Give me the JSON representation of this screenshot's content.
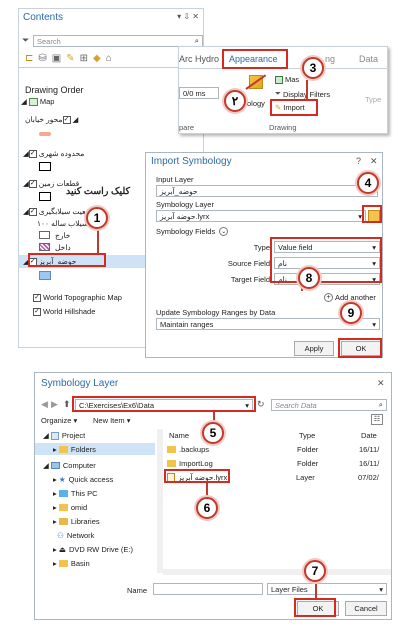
{
  "contents": {
    "title": "Contents",
    "search_placeholder": "Search",
    "drawing_order": "Drawing Order",
    "layers": {
      "map": "Map",
      "street_axis": "محور خیابان",
      "city_limit": "محدوده شهری",
      "land_parcels": "قطعات زمین",
      "flood_status": "وضعیت سیلابگیری",
      "flood_100": "۱۰۰ سیلاب ساله",
      "outside": "خارج",
      "inside": "داخل",
      "basin": "حوضه_آبریز",
      "topo": "World Topographic Map",
      "hillshade": "World Hillshade"
    },
    "callout_rightclick": "کلیک راست کنید"
  },
  "ribbon": {
    "tab_arc_hydro": "Arc Hydro",
    "tab_appearance": "Appearance",
    "tab_labeling": "ng",
    "tab_data": "Data",
    "zoom_value": "0/0 ms",
    "symbology_label": "ology",
    "mask": "Mas",
    "display_filters": "Display Filters",
    "import": "Import",
    "type_label": "Type",
    "group_compare": "pare",
    "group_drawing": "Drawing"
  },
  "import_dialog": {
    "title": "Import Symbology",
    "help": "?",
    "input_layer_label": "Input Layer",
    "input_layer_value": "حوضه_آبریز",
    "symbology_layer_label": "Symbology Layer",
    "symbology_layer_value": "حوضه آبریز.lyrx",
    "symbology_fields_label": "Symbology Fields",
    "type_label": "Type",
    "type_value": "Value field",
    "source_field_label": "Source Field",
    "source_field_value": "نام",
    "target_field_label": "Target Field",
    "target_field_value": "نام",
    "add_another": "Add another",
    "update_ranges_label": "Update Symbology Ranges by Data",
    "update_ranges_value": "Maintain ranges",
    "apply": "Apply",
    "ok": "OK"
  },
  "file_dialog": {
    "title": "Symbology Layer",
    "path": "C:\\Exercises\\Ex6\\Data",
    "search_placeholder": "Search Data",
    "organize": "Organize ▾",
    "new_item": "New Item ▾",
    "nav": [
      "Project",
      "Folders",
      "Computer",
      "Quick access",
      "This PC",
      "omid",
      "Libraries",
      "Network",
      "DVD RW Drive (E:)",
      "Basin"
    ],
    "columns": {
      "name": "Name",
      "type": "Type",
      "date": "Date"
    },
    "files": [
      {
        "name": ".backups",
        "type": "Folder",
        "date": "16/11/"
      },
      {
        "name": "ImportLog",
        "type": "Folder",
        "date": "16/11/"
      },
      {
        "name": "حوضه آبریز.lyrx",
        "type": "Layer",
        "date": "07/02/"
      }
    ],
    "name_label": "Name",
    "filter_value": "Layer Files",
    "ok": "OK",
    "cancel": "Cancel"
  },
  "markers": [
    "1",
    "۲",
    "3",
    "4",
    "5",
    "6",
    "7",
    "8",
    "9"
  ],
  "colors": {
    "accent_red": "#d42b20",
    "title_blue": "#2a6aa8",
    "selection_blue": "#cfe3f7"
  }
}
